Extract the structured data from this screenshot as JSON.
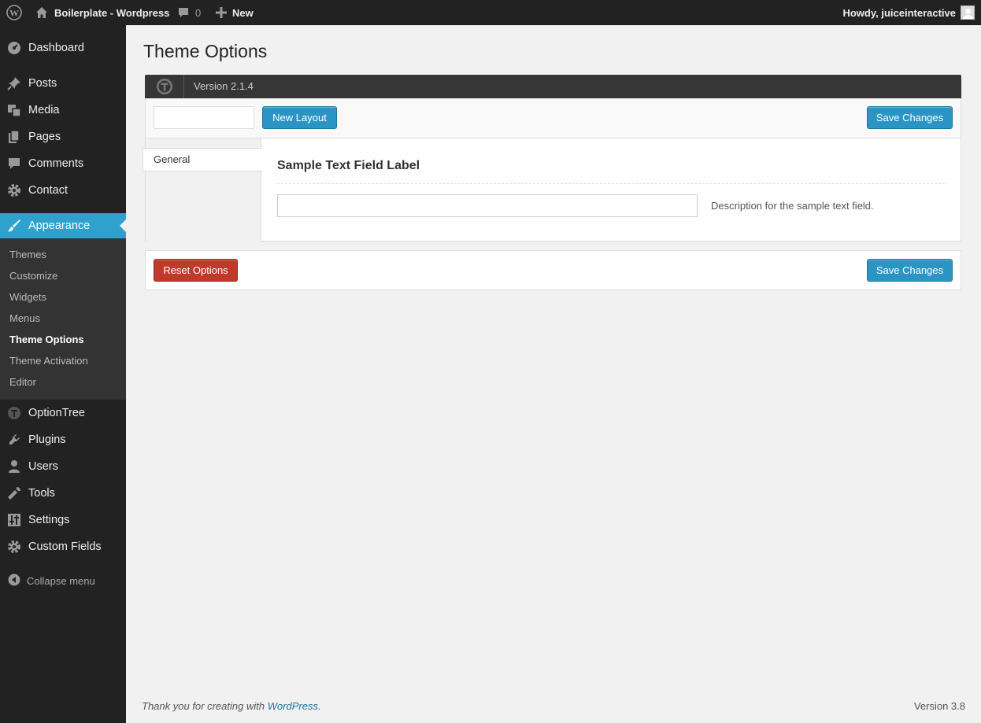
{
  "adminbar": {
    "site_name": "Boilerplate - Wordpress",
    "comments_count": "0",
    "new_label": "New",
    "account_label": "Howdy, juiceinteractive"
  },
  "sidebar": {
    "items": [
      {
        "label": "Dashboard",
        "icon": "dashboard-icon"
      },
      {
        "label": "Posts",
        "icon": "pin-icon"
      },
      {
        "label": "Media",
        "icon": "media-icon"
      },
      {
        "label": "Pages",
        "icon": "pages-icon"
      },
      {
        "label": "Comments",
        "icon": "comment-icon"
      },
      {
        "label": "Contact",
        "icon": "gear-icon"
      },
      {
        "label": "Appearance",
        "icon": "brush-icon"
      },
      {
        "label": "OptionTree",
        "icon": "optiontree-icon"
      },
      {
        "label": "Plugins",
        "icon": "plug-icon"
      },
      {
        "label": "Users",
        "icon": "user-icon"
      },
      {
        "label": "Tools",
        "icon": "wrench-icon"
      },
      {
        "label": "Settings",
        "icon": "sliders-icon"
      },
      {
        "label": "Custom Fields",
        "icon": "gear-icon"
      }
    ],
    "submenu": [
      "Themes",
      "Customize",
      "Widgets",
      "Menus",
      "Theme Options",
      "Theme Activation",
      "Editor"
    ],
    "collapse_label": "Collapse menu"
  },
  "page": {
    "title": "Theme Options",
    "version": "Version 2.1.4",
    "new_layout_label": "New Layout",
    "save_label": "Save Changes",
    "reset_label": "Reset Options",
    "tab_general": "General",
    "field_label": "Sample Text Field Label",
    "field_value": "",
    "field_description": "Description for the sample text field.",
    "layout_name_value": ""
  },
  "footer": {
    "thanks_prefix": "Thank you for creating with ",
    "thanks_link": "WordPress",
    "thanks_suffix": ".",
    "version": "Version 3.8"
  },
  "colors": {
    "accent": "#2ea2cc",
    "button_blue": "#2a95c5",
    "button_red": "#c0392b",
    "adminbar_bg": "#222222"
  }
}
